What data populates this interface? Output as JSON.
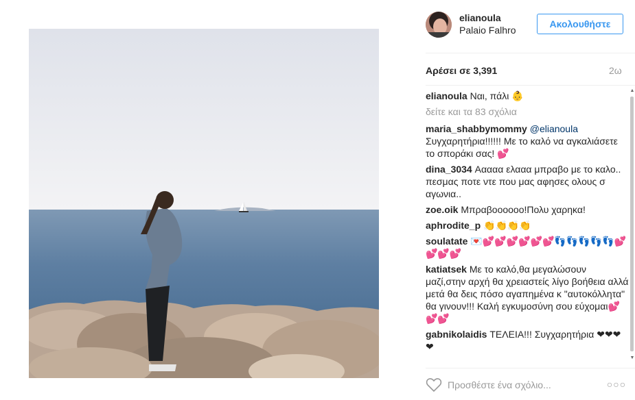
{
  "post": {
    "username": "elianoula",
    "location": "Palaio Falhro",
    "follow_label": "Ακολουθήστε",
    "likes_label": "Αρέσει σε 3,391",
    "time_ago": "2ω"
  },
  "caption": {
    "username": "elianoula",
    "text": "Ναι, πάλι 👶"
  },
  "view_all_comments": "δείτε και τα 83 σχόλια",
  "comments": [
    {
      "username": "maria_shabbymommy",
      "mention": "@elianoula",
      "text": "Συγχαρητήρια!!!!!! Με το καλό να αγκαλιάσετε το σποράκι σας! 💕"
    },
    {
      "username": "dina_3034",
      "mention": "",
      "text": "Ααααα ελααα μπραβο με το καλο.. πεσμας ποτε ντε που μας αφησες ολους σ αγωνια.."
    },
    {
      "username": "zoe.oik",
      "mention": "",
      "text": "Μπραβοοοοοο!Πολυ χαρηκα!"
    },
    {
      "username": "aphrodite_p",
      "mention": "",
      "text": "👏👏👏👏"
    },
    {
      "username": "soulatate",
      "mention": "",
      "text": "💌💕💕💕💕💕💕👣👣👣👣👣💕💕💕💕"
    },
    {
      "username": "katiatsek",
      "mention": "",
      "text": "Με το καλό,θα μεγαλώσουν μαζί,στην αρχή θα χρειαστείς λίγο βοήθεια αλλά μετά θα δεις πόσο αγαπημένα κ \"αυτοκόλλητα\" θα γινουν!!! Καλή εγκυμοσύνη σου εύχομαι💕💕💕"
    },
    {
      "username": "gabnikolaidis",
      "mention": "",
      "text": "ΤΕΛΕΙΑ!!! Συγχαρητήρια ❤❤❤❤"
    }
  ],
  "footer": {
    "comment_placeholder": "Προσθέστε ένα σχόλιο...",
    "more_label": "○○○"
  },
  "icons": {
    "heart": "heart-icon",
    "more": "more-options-icon"
  },
  "colors": {
    "follow_blue": "#3897f0",
    "mention_blue": "#003569",
    "muted": "#999999"
  }
}
